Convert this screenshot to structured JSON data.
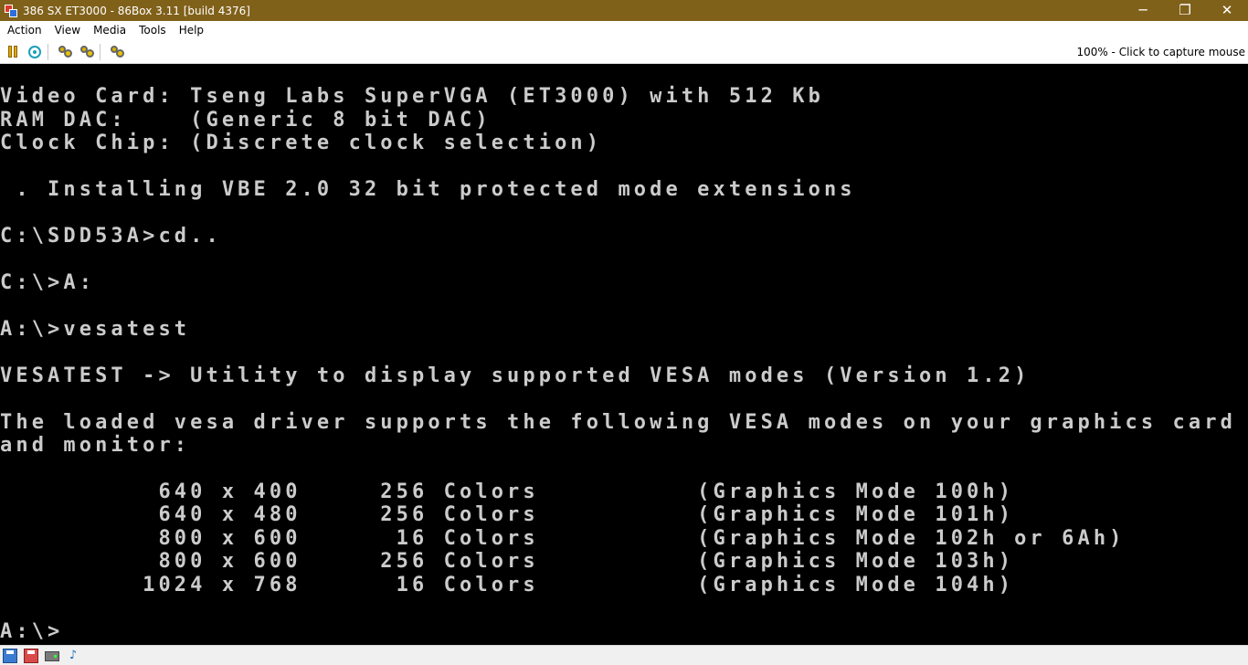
{
  "window": {
    "title": "386 SX ET3000 - 86Box 3.11 [build 4376]",
    "minimize_glyph": "─",
    "restore_glyph": "❐",
    "close_glyph": "✕"
  },
  "menu": [
    "Action",
    "View",
    "Media",
    "Tools",
    "Help"
  ],
  "toolbar": {
    "icons": [
      "pause-icon",
      "hard-reset-icon",
      "ctrl-alt-del-icon",
      "ctrl-alt-esc-icon",
      "settings-icon"
    ],
    "capture_text": "100% - Click to capture mouse"
  },
  "screen": {
    "lines": [
      "Video Card: Tseng Labs SuperVGA (ET3000) with 512 Kb",
      "RAM DAC:    (Generic 8 bit DAC)",
      "Clock Chip: (Discrete clock selection)",
      "",
      " . Installing VBE 2.0 32 bit protected mode extensions",
      "",
      "C:\\SDD53A>cd..",
      "",
      "C:\\>A:",
      "",
      "A:\\>vesatest",
      "",
      "VESATEST -> Utility to display supported VESA modes (Version 1.2)",
      "",
      "The loaded vesa driver supports the following VESA modes on your graphics card",
      "and monitor:",
      "",
      "          640 x 400     256 Colors          (Graphics Mode 100h)",
      "          640 x 480     256 Colors          (Graphics Mode 101h)",
      "          800 x 600      16 Colors          (Graphics Mode 102h or 6Ah)",
      "          800 x 600     256 Colors          (Graphics Mode 103h)",
      "         1024 x 768      16 Colors          (Graphics Mode 104h)",
      "",
      "A:\\>"
    ]
  },
  "statusbar": {
    "icons": [
      "floppy-a-icon",
      "floppy-b-icon",
      "hard-disk-icon",
      "sound-icon"
    ]
  },
  "colors": {
    "titlebar": "#80611a",
    "screen_text": "#cbcbcb",
    "screen_bg": "#000000"
  }
}
